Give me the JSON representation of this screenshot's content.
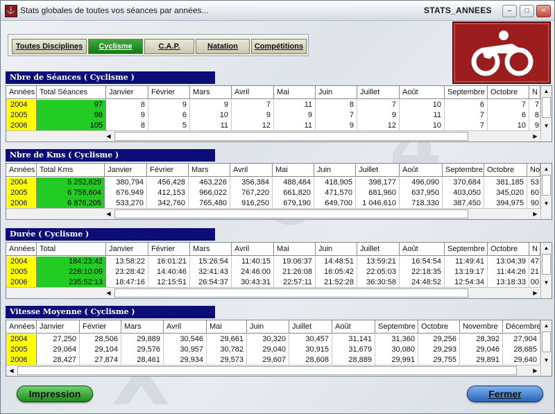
{
  "window": {
    "title": "Stats globales de toutes vos séances par années...",
    "id_label": "STATS_ANNEES",
    "app_icon": "bike-icon"
  },
  "tabs": [
    {
      "label": "Toutes Disciplines",
      "active": false
    },
    {
      "label": "Cyclisme",
      "active": true
    },
    {
      "label": "C.A.P.",
      "active": false
    },
    {
      "label": "Natation",
      "active": false
    },
    {
      "label": "Compétitions",
      "active": false
    }
  ],
  "colors": {
    "section_header": "#0d0d7a",
    "year_cell": "#ffff00",
    "total_cell": "#22cc22",
    "active_tab": "#1a8a1a",
    "logo_bg": "#9b1d1d"
  },
  "tables": [
    {
      "title": "Nbre de Séances ( Cyclisme )",
      "columns": [
        "Années",
        "Total Séances",
        "Janvier",
        "Février",
        "Mars",
        "Avril",
        "Mai",
        "Juin",
        "Juillet",
        "Août",
        "Septembre",
        "Octobre",
        "N"
      ],
      "rows": [
        [
          "2004",
          "97",
          "8",
          "9",
          "9",
          "7",
          "11",
          "8",
          "7",
          "10",
          "6",
          "7",
          "7"
        ],
        [
          "2005",
          "98",
          "9",
          "6",
          "10",
          "9",
          "9",
          "7",
          "9",
          "11",
          "7",
          "6",
          "8"
        ],
        [
          "2006",
          "105",
          "8",
          "5",
          "11",
          "12",
          "11",
          "9",
          "12",
          "10",
          "7",
          "10",
          "9"
        ]
      ]
    },
    {
      "title": "Nbre de Kms  ( Cyclisme )",
      "columns": [
        "Années",
        "Total Kms",
        "Janvier",
        "Février",
        "Mars",
        "Avril",
        "Mai",
        "Juin",
        "Juillet",
        "Août",
        "Septembre",
        "Octobre",
        "No"
      ],
      "rows": [
        [
          "2004",
          "5 252,629",
          "380,794",
          "456,428",
          "463,226",
          "356,384",
          "488,484",
          "418,905",
          "398,177",
          "496,090",
          "370,684",
          "381,185",
          "53"
        ],
        [
          "2005",
          "6 758,604",
          "676,949",
          "412,153",
          "966,022",
          "767,220",
          "661,820",
          "471,570",
          "681,960",
          "637,950",
          "403,050",
          "345,020",
          "60"
        ],
        [
          "2006",
          "6 876,205",
          "533,270",
          "342,760",
          "765,480",
          "916,250",
          "679,190",
          "649,700",
          "1 046,610",
          "718,330",
          "387,450",
          "394,975",
          "90"
        ]
      ]
    },
    {
      "title": "Durée  ( Cyclisme )",
      "columns": [
        "Années",
        "Total",
        "Janvier",
        "Février",
        "Mars",
        "Avril",
        "Mai",
        "Juin",
        "Juillet",
        "Août",
        "Septembre",
        "Octobre",
        "N"
      ],
      "rows": [
        [
          "2004",
          "184:23:42",
          "13:58:22",
          "16:01:21",
          "15:26:54",
          "11:40:15",
          "19:06:37",
          "14:48:51",
          "13:59:21",
          "16:54:54",
          "11:49:41",
          "13:04:39",
          "47"
        ],
        [
          "2005",
          "228:10:09",
          "23:28:42",
          "14:40:46",
          "32:41:43",
          "24:46:00",
          "21:26:08",
          "16:05:42",
          "22:05:03",
          "22:18:35",
          "13:19:17",
          "11:44:26",
          "21"
        ],
        [
          "2006",
          "235:52:13",
          "18:47:16",
          "12:15:51",
          "26:54:37",
          "30:43:31",
          "22:57:11",
          "21:52:28",
          "36:30:58",
          "24:48:52",
          "12:54:34",
          "13:18:33",
          "00"
        ]
      ]
    },
    {
      "title": "Vitesse Moyenne ( Cyclisme )",
      "columns": [
        "Années",
        "Janvier",
        "Février",
        "Mars",
        "Avril",
        "Mai",
        "Juin",
        "Juillet",
        "Août",
        "Septembre",
        "Octobre",
        "Novembre",
        "Décembre"
      ],
      "rows": [
        [
          "2004",
          "27,250",
          "28,506",
          "29,889",
          "30,546",
          "29,661",
          "30,320",
          "30,457",
          "31,141",
          "31,360",
          "29,256",
          "28,392",
          "27,904"
        ],
        [
          "2005",
          "29,064",
          "29,104",
          "29,576",
          "30,957",
          "30,782",
          "29,040",
          "30,915",
          "31,679",
          "30,080",
          "29,293",
          "29,046",
          "28,685"
        ],
        [
          "2006",
          "28,427",
          "27,874",
          "28,461",
          "29,934",
          "29,573",
          "29,607",
          "28,608",
          "28,889",
          "29,991",
          "29,755",
          "29,891",
          "29,640"
        ]
      ]
    }
  ],
  "buttons": {
    "print": "Impression",
    "close": "Fermer"
  }
}
